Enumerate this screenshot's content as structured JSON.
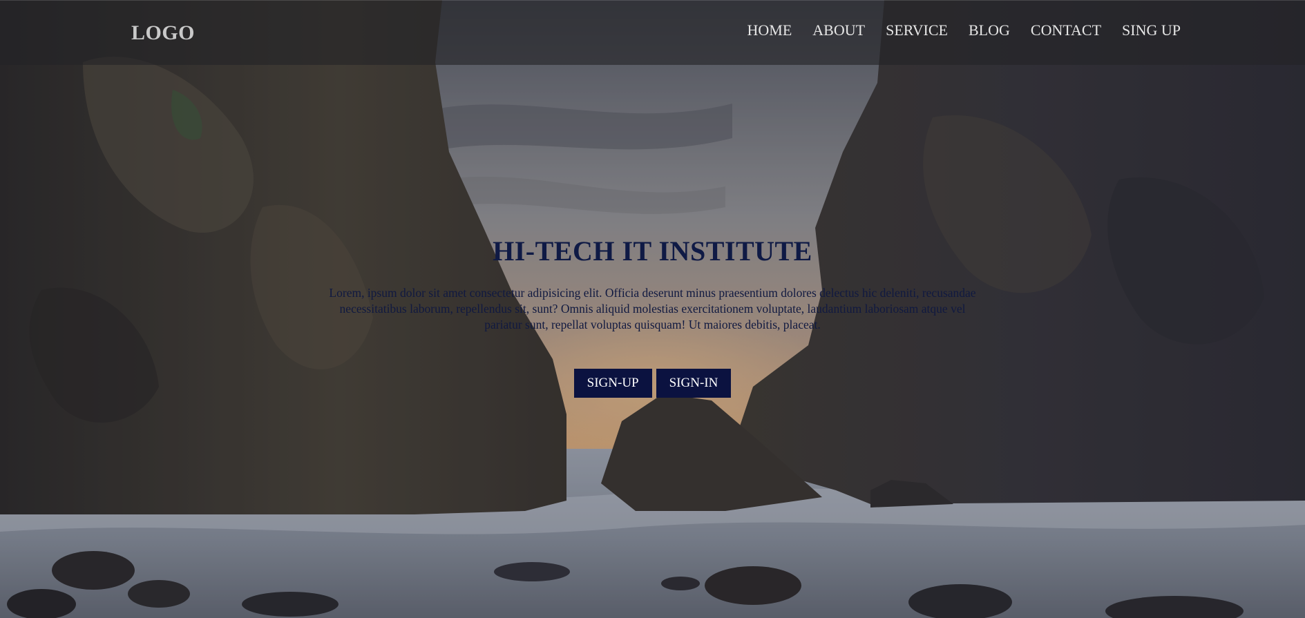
{
  "header": {
    "logo": "LOGO",
    "nav": [
      {
        "label": "HOME"
      },
      {
        "label": "ABOUT"
      },
      {
        "label": "SERVICE"
      },
      {
        "label": "BLOG"
      },
      {
        "label": "CONTACT"
      },
      {
        "label": "SING UP"
      }
    ]
  },
  "hero": {
    "title": "HI-TECH IT INSTITUTE",
    "description": "Lorem, ipsum dolor sit amet consectetur adipisicing elit. Officia deserunt minus praesentium dolores delectus hic deleniti, recusandae necessitatibus laborum, repellendus sit, sunt? Omnis aliquid molestias exercitationem voluptate, laudantium laboriosam atque vel pariatur sunt, repellat voluptas quisquam! Ut maiores debitis, placeat.",
    "buttons": {
      "signup": "SIGN-UP",
      "signin": "SIGN-IN"
    }
  },
  "colors": {
    "title": "#0f1a45",
    "button_bg": "#0b1240",
    "navbar_bg": "rgba(35,35,38,0.62)"
  }
}
